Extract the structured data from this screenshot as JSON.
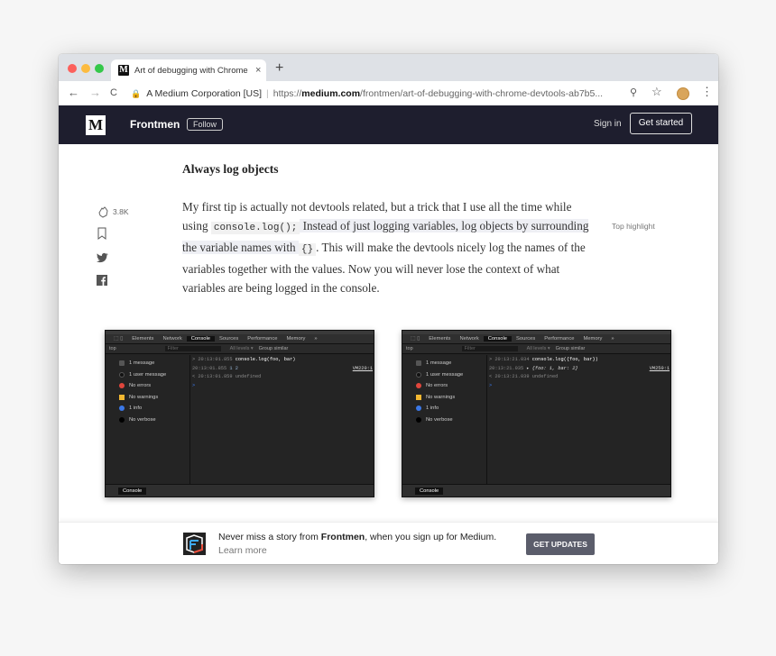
{
  "browser": {
    "tab_title": "Art of debugging with Chrome DevTools",
    "tab_close": "×",
    "new_tab": "+",
    "url_org": "A Medium Corporation [US]",
    "url_scheme": "https://",
    "url_host": "medium.com",
    "url_path": "/frontmen/art-of-debugging-with-chrome-devtools-ab7b5...",
    "nav_back": "←",
    "nav_forward": "→",
    "nav_reload": "C",
    "zoom_icon": "⚲",
    "star_icon": "☆",
    "menu_icon": "⋮",
    "lock": "🔒"
  },
  "header": {
    "logo": "M",
    "publication": "Frontmen",
    "follow": "Follow",
    "sign_in": "Sign in",
    "get_started": "Get started"
  },
  "article": {
    "heading": "Always log objects",
    "p1": "My first tip is actually not devtools related, but a trick that I use all the time while using ",
    "code1": "console.log();",
    "p2": " Instead of just logging variables, log objects by surrounding the variable names with ",
    "code2": "{}",
    "p3": ". This will make the devtools nicely log the names of the variables together with the values. Now you will never lose the context of what variables are being logged in the console.",
    "top_highlight": "Top highlight",
    "claps": "3.8K"
  },
  "devtools": [
    {
      "tabs": [
        "Elements",
        "Network",
        "Console",
        "Sources",
        "Performance",
        "Memory",
        "»"
      ],
      "active_tab": "Console",
      "context": "top",
      "filter_placeholder": "Filter",
      "levels": "All levels ▾",
      "group_similar": "Group similar",
      "sidebar": [
        "1 message",
        "1 user message",
        "No errors",
        "No warnings",
        "1 info",
        "No verbose"
      ],
      "lines": [
        {
          "ts": "> 20:13:01.855",
          "text": "console.log(foo, bar)"
        },
        {
          "ts": "  20:13:01.855",
          "text": "1 2",
          "ref": "VM220:1"
        },
        {
          "ts": "< 20:13:01.859",
          "text": "undefined"
        },
        {
          "ts": ">",
          "text": ""
        }
      ],
      "drawer": "Console"
    },
    {
      "tabs": [
        "Elements",
        "Network",
        "Console",
        "Sources",
        "Performance",
        "Memory",
        "»"
      ],
      "active_tab": "Console",
      "context": "top",
      "filter_placeholder": "Filter",
      "levels": "All levels ▾",
      "group_similar": "Group similar",
      "sidebar": [
        "1 message",
        "1 user message",
        "No errors",
        "No warnings",
        "1 info",
        "No verbose"
      ],
      "lines": [
        {
          "ts": "> 20:13:21.034",
          "text": "console.log({foo, bar})"
        },
        {
          "ts": "  20:13:21.035",
          "text": "▸ {foo: 1, bar: 2}",
          "ref": "VM250:1"
        },
        {
          "ts": "< 20:13:21.039",
          "text": "undefined"
        },
        {
          "ts": ">",
          "text": ""
        }
      ],
      "drawer": "Console"
    }
  ],
  "footer": {
    "text_before": "Never miss a story from ",
    "publication": "Frontmen",
    "text_after": ", when you sign up for Medium.",
    "learn_more": "Learn more",
    "get_updates": "GET UPDATES"
  },
  "colors": {
    "header_bg": "#1e1e2e",
    "traffic_red": "#fc605c",
    "traffic_yellow": "#fcbb40",
    "traffic_green": "#34c84a",
    "button_bg": "#5b5d6b"
  }
}
